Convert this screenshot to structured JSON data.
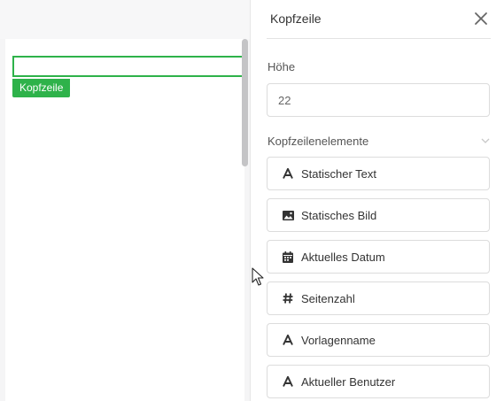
{
  "canvas": {
    "header_tag": "Kopfzeile"
  },
  "panel": {
    "title": "Kopfzeile",
    "height_label": "Höhe",
    "height_value": "22",
    "elements_label": "Kopfzeilenelemente",
    "elements": [
      {
        "label": "Statischer Text",
        "icon": "text-a-icon"
      },
      {
        "label": "Statisches Bild",
        "icon": "image-icon"
      },
      {
        "label": "Aktuelles Datum",
        "icon": "calendar-icon"
      },
      {
        "label": "Seitenzahl",
        "icon": "hash-icon"
      },
      {
        "label": "Vorlagenname",
        "icon": "text-a-icon"
      },
      {
        "label": "Aktueller Benutzer",
        "icon": "text-a-icon"
      }
    ]
  },
  "colors": {
    "accent_green": "#2eb24a",
    "panel_bg": "#ffffff",
    "canvas_bg": "#f5f5f6"
  }
}
